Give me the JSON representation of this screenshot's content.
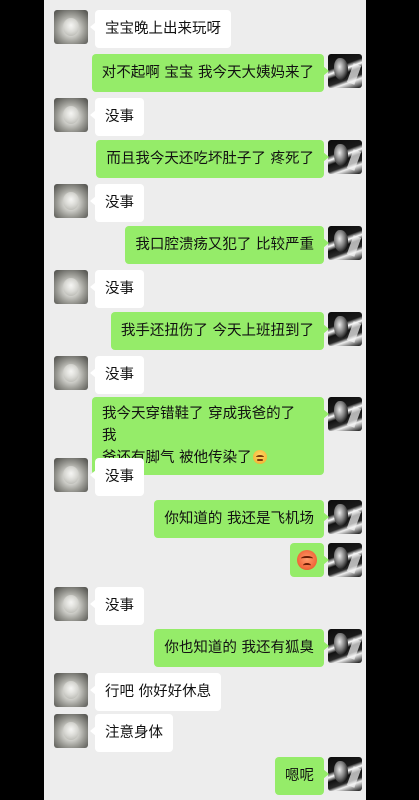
{
  "chat": {
    "messages": [
      {
        "side": "in",
        "text": "宝宝晚上出来玩呀"
      },
      {
        "side": "out",
        "text": "对不起啊 宝宝 我今天大姨妈来了"
      },
      {
        "side": "in",
        "text": "没事"
      },
      {
        "side": "out",
        "text": "而且我今天还吃坏肚子了 疼死了"
      },
      {
        "side": "in",
        "text": "没事"
      },
      {
        "side": "out",
        "text": "我口腔溃疡又犯了 比较严重"
      },
      {
        "side": "in",
        "text": "没事"
      },
      {
        "side": "out",
        "text": "我手还扭伤了 今天上班扭到了"
      },
      {
        "side": "in",
        "text": "没事"
      },
      {
        "side": "out",
        "text_line1": "我今天穿错鞋了 穿成我爸的了 我",
        "text_line2": "爸还有脚气 被他传染了",
        "emoji": "grimace-emoji"
      },
      {
        "side": "in",
        "text": "没事"
      },
      {
        "side": "out",
        "text": "你知道的 我还是飞机场"
      },
      {
        "side": "out",
        "emoji": "angry-emoji"
      },
      {
        "side": "in",
        "text": "没事"
      },
      {
        "side": "out",
        "text": "你也知道的 我还有狐臭"
      },
      {
        "side": "in",
        "text": "行吧 你好好休息"
      },
      {
        "side": "in",
        "text": "注意身体"
      },
      {
        "side": "out",
        "text": "嗯呢"
      }
    ]
  },
  "colors": {
    "background": "#ededed",
    "outgoing_bubble": "#95ec69",
    "incoming_bubble": "#ffffff"
  }
}
